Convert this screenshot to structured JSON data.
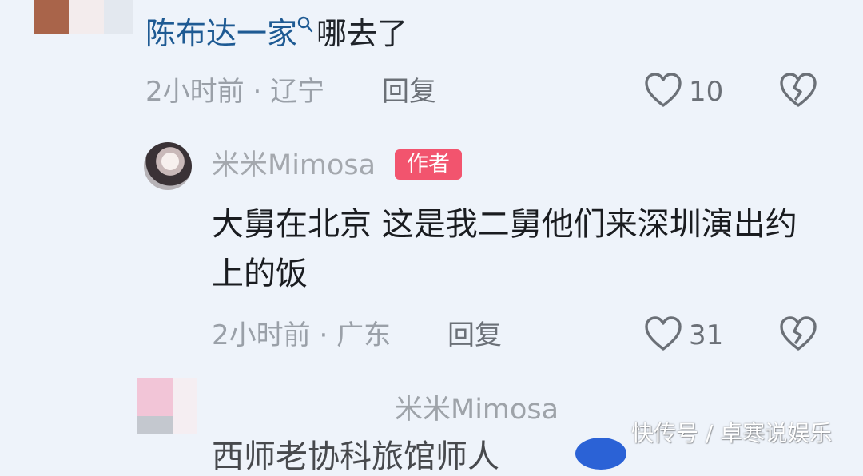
{
  "comment1": {
    "mention_text": "陈布达一家",
    "mention_icon": "search-icon",
    "text_after": "哪去了",
    "time": "2小时前",
    "location": "辽宁",
    "reply_label": "回复",
    "like_count": "10"
  },
  "reply1": {
    "username": "米米Mimosa",
    "badge": "作者",
    "text": "大舅在北京 这是我二舅他们来深圳演出约上的饭",
    "time": "2小时前",
    "location": "广东",
    "reply_label": "回复",
    "like_count": "31"
  },
  "reply2": {
    "username_partial": "米米Mimosa",
    "text_partial": "西师老协科旅馆师人"
  },
  "separator": "·",
  "watermark": "快传号 / 卓寒说娱乐",
  "colors": {
    "background": "#eef3fa",
    "mention": "#1e5a93",
    "badge": "#f2546e",
    "meta": "#9aa0a8"
  }
}
